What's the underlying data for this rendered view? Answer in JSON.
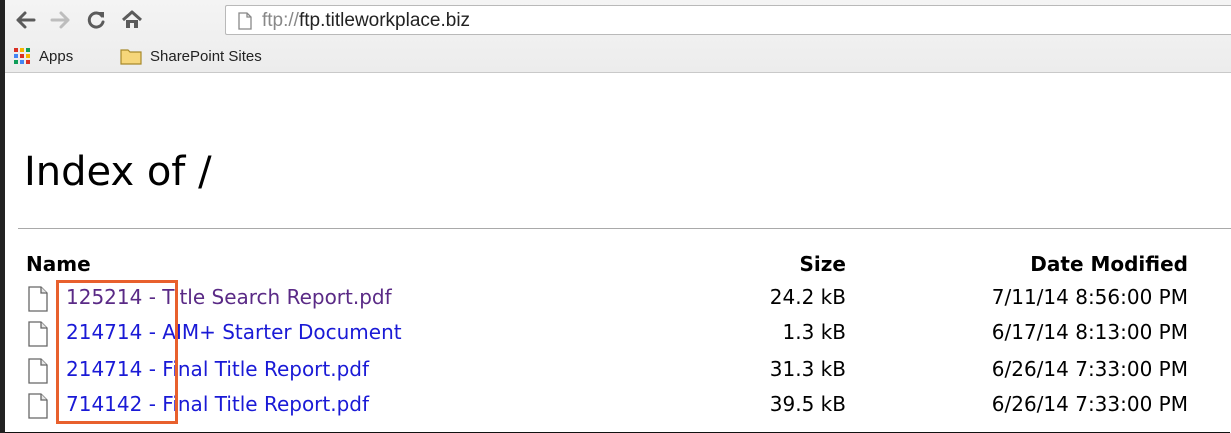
{
  "browser": {
    "url_scheme": "ftp://",
    "url_host": "ftp.titleworkplace.biz",
    "bookmarks": [
      {
        "label": "Apps",
        "icon": "apps-grid-icon"
      },
      {
        "label": "SharePoint Sites",
        "icon": "folder-icon"
      }
    ]
  },
  "page": {
    "title": "Index of /",
    "columns": {
      "name": "Name",
      "size": "Size",
      "date": "Date Modified"
    },
    "files": [
      {
        "name": "125214 - Title Search Report.pdf",
        "size": "24.2 kB",
        "date": "7/11/14 8:56:00 PM",
        "visited": true
      },
      {
        "name": "214714 - AIM+ Starter Document",
        "size": "1.3 kB",
        "date": "6/17/14 8:13:00 PM",
        "visited": false
      },
      {
        "name": "214714 - Final Title Report.pdf",
        "size": "31.3 kB",
        "date": "6/26/14 7:33:00 PM",
        "visited": false
      },
      {
        "name": "714142 - Final Title Report.pdf",
        "size": "39.5 kB",
        "date": "6/26/14 7:33:00 PM",
        "visited": false
      }
    ]
  },
  "colors": {
    "highlight": "#e8602d",
    "link": "#1a1ad6",
    "visited_link": "#5a2a86"
  }
}
